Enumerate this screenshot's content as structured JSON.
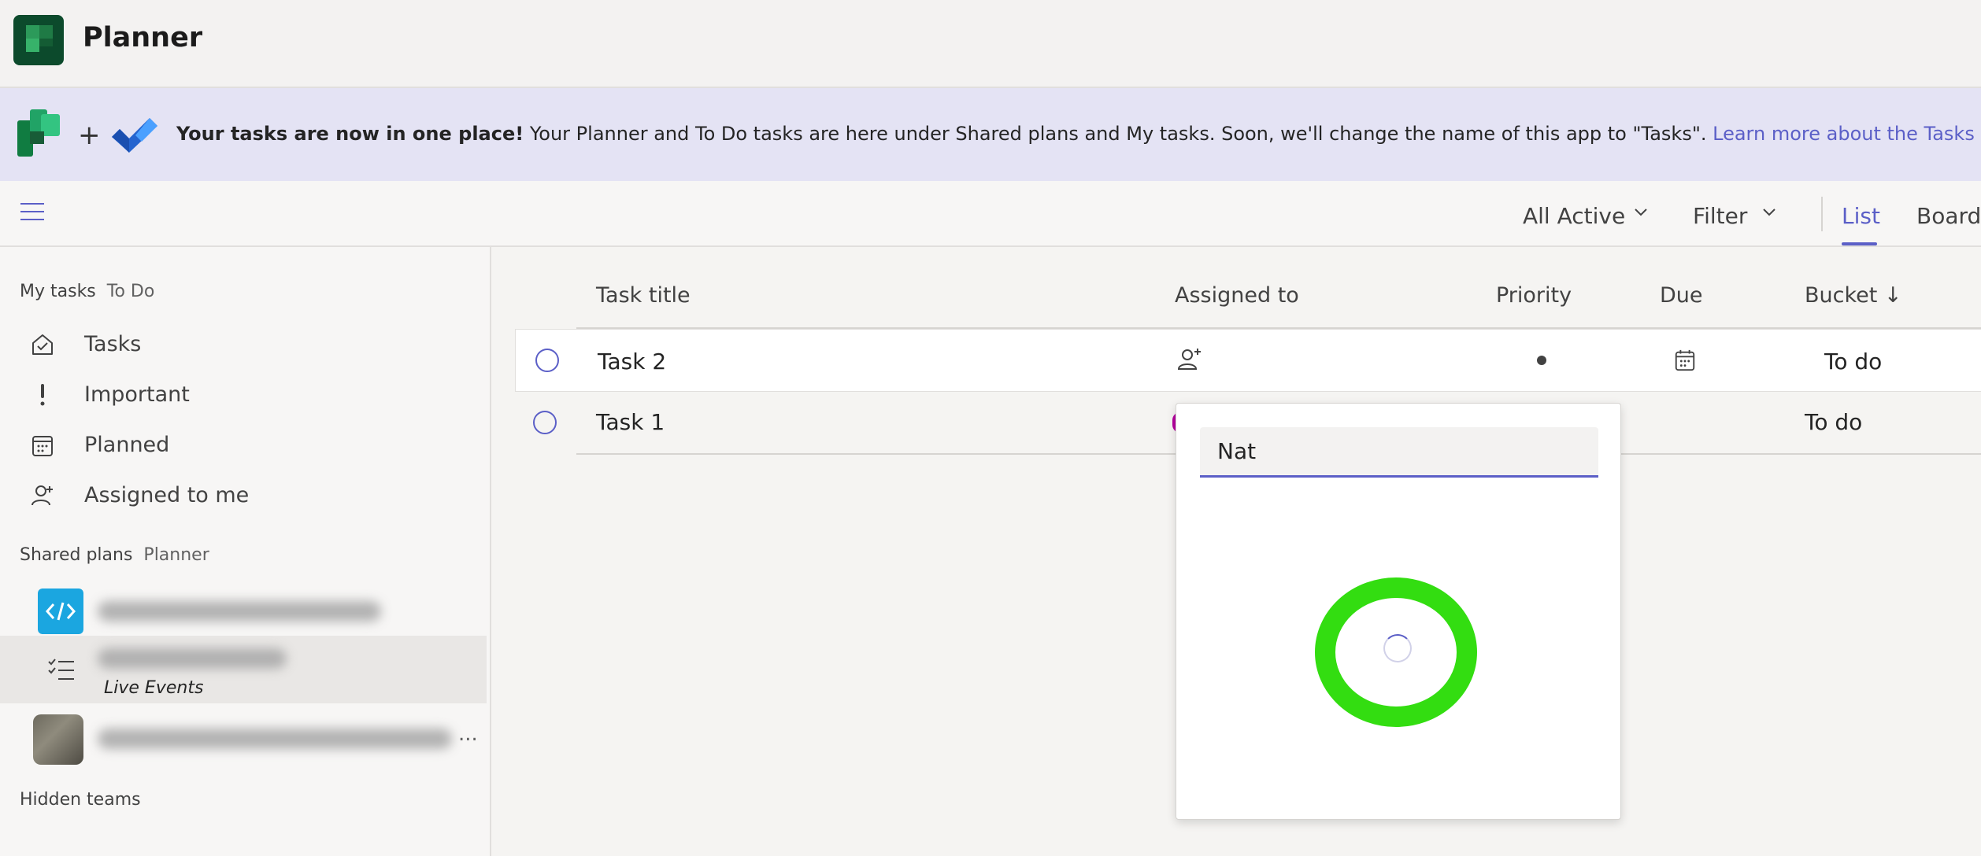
{
  "app": {
    "title": "Planner"
  },
  "banner": {
    "plus": "+",
    "bold": "Your tasks are now in one place!",
    "text": " Your Planner and To Do tasks are here under Shared plans and My tasks. Soon, we'll change the name of this app to \"Tasks\".  ",
    "link": "Learn more about the Tasks app."
  },
  "toolbar": {
    "filter_active": "All Active",
    "filter": "Filter",
    "tab_list": "List",
    "tab_board": "Board"
  },
  "sidebar": {
    "my_tasks": {
      "title": "My tasks",
      "sub": "To Do"
    },
    "items": [
      {
        "label": "Tasks",
        "icon": "home-check-icon"
      },
      {
        "label": "Important",
        "icon": "exclamation-icon"
      },
      {
        "label": "Planned",
        "icon": "calendar-icon"
      },
      {
        "label": "Assigned to me",
        "icon": "person-icon"
      }
    ],
    "shared": {
      "title": "Shared plans",
      "sub": "Planner"
    },
    "plan_sub": "Live Events",
    "ellipsis": "...",
    "hidden_teams": "Hidden teams"
  },
  "table": {
    "columns": [
      "Task title",
      "Assigned to",
      "Priority",
      "Due",
      "Bucket ↓"
    ],
    "rows": [
      {
        "title": "Task 2",
        "bucket": "To do"
      },
      {
        "title": "Task 1",
        "bucket": "To do"
      }
    ]
  },
  "popup": {
    "search_value": "Nat"
  },
  "colors": {
    "accent": "#5b5fc7",
    "banner_bg": "#e4e3f4",
    "highlight": "#33dd11"
  }
}
